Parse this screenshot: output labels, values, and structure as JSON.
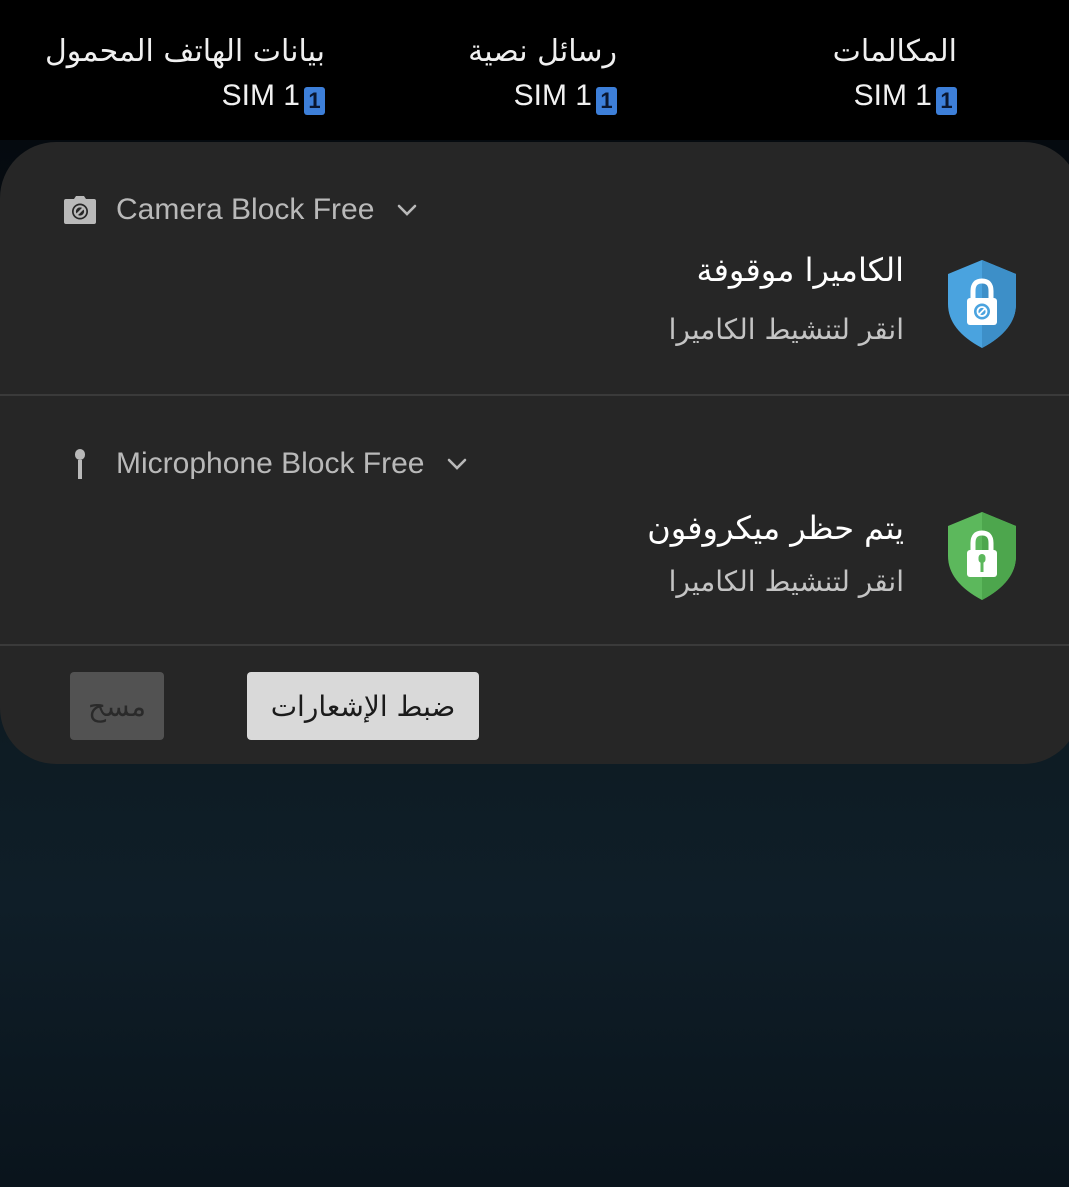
{
  "sim_strip": {
    "columns": [
      {
        "label": "بيانات الهاتف المحمول",
        "sim": "SIM 1",
        "badge": "1"
      },
      {
        "label": "رسائل نصية",
        "sim": "SIM 1",
        "badge": "1"
      },
      {
        "label": "المكالمات",
        "sim": "SIM 1",
        "badge": "1"
      }
    ],
    "badge_color": "#3d7fd9"
  },
  "notifications": [
    {
      "app_name": "Camera Block Free",
      "app_icon": "camera-block-icon",
      "title": "الكاميرا موقوفة",
      "text": "انقر لتنشيط الكاميرا",
      "shield_icon": "camera-lock-shield-icon",
      "shield_color": "#4aa3df"
    },
    {
      "app_name": "Microphone Block Free",
      "app_icon": "microphone-icon",
      "title": "يتم حظر ميكروفون",
      "text": "انقر لتنشيط الكاميرا",
      "shield_icon": "microphone-lock-shield-icon",
      "shield_color": "#5cb85c"
    }
  ],
  "actions": {
    "settings_label": "ضبط الإشعارات",
    "clear_label": "مسح"
  },
  "colors": {
    "panel_bg": "#262626",
    "settings_button_bg": "#d9d9d9",
    "clear_button_bg": "#525252"
  }
}
